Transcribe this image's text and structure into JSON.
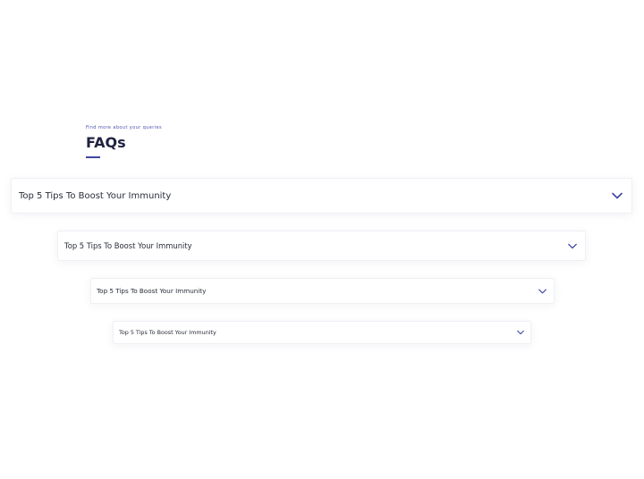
{
  "section": {
    "eyebrow": "Find more about your queries",
    "title": "FAQs"
  },
  "faqs": [
    {
      "question": "Top 5 Tips To Boost Your Immunity",
      "icon": "chevron-down-icon",
      "expanded": false
    },
    {
      "question": "Top 5 Tips To Boost Your Immunity",
      "icon": "chevron-down-icon",
      "expanded": false
    },
    {
      "question": "Top 5 Tips To Boost Your Immunity",
      "icon": "chevron-down-icon",
      "expanded": false
    },
    {
      "question": "Top 5 Tips To Boost Your Immunity",
      "icon": "chevron-down-icon",
      "expanded": false
    }
  ],
  "colors": {
    "accent": "#3f469f",
    "eyebrow": "#4a52b0",
    "title": "#1f2340",
    "text": "#2a2d3a"
  }
}
